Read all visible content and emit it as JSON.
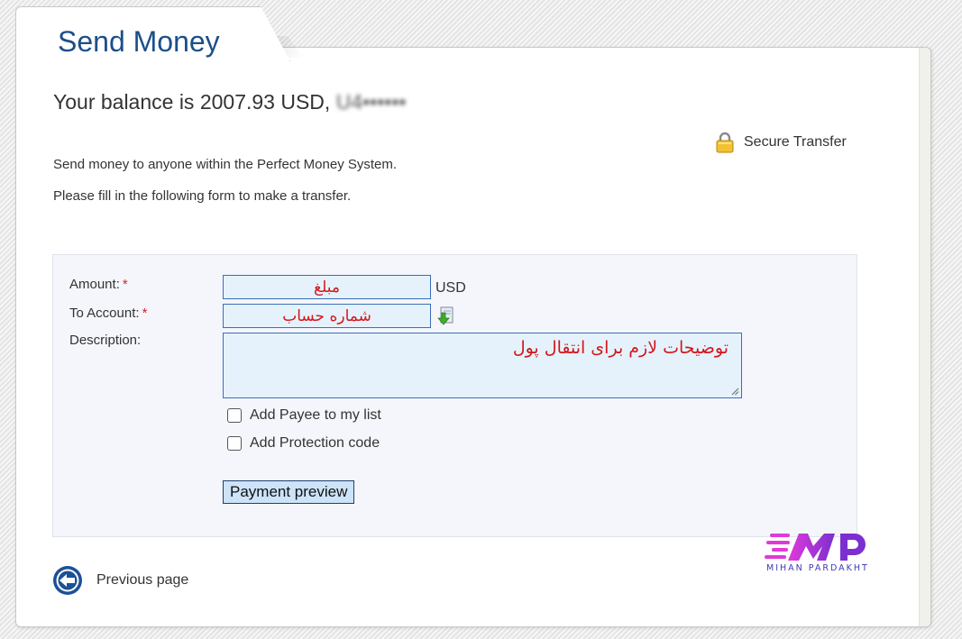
{
  "tab": {
    "title": "Send Money"
  },
  "balance": {
    "prefix": "Your balance is 2007.93 USD, ",
    "account_masked": "U4••••••"
  },
  "secure": {
    "label": "Secure Transfer"
  },
  "intro": {
    "line1": "Send money to anyone within the Perfect Money System.",
    "line2": "Please fill in the following form to make a transfer."
  },
  "form": {
    "amount": {
      "label": "Amount:",
      "required_mark": "*",
      "value": "مبلغ",
      "unit": "USD"
    },
    "to_account": {
      "label": "To Account:",
      "required_mark": "*",
      "value": "شماره حساب"
    },
    "description": {
      "label": "Description:",
      "value": "توضیحات لازم برای انتقال پول"
    },
    "add_payee": {
      "label": "Add Payee to my list",
      "checked": false
    },
    "add_protection": {
      "label": "Add Protection code",
      "checked": false
    },
    "submit_label": "Payment preview"
  },
  "footer": {
    "previous_label": "Previous page"
  },
  "watermark": {
    "brand": "MIHAN PARDAKHT"
  },
  "colors": {
    "title": "#1b4f8a",
    "field_bg": "#e5f2fc",
    "field_border": "#3a6fb8",
    "annotation_red": "#d4161a",
    "brand_purple": "#7b2fd0",
    "brand_pink": "#e03ad8"
  },
  "icons": {
    "lock": "lock-icon",
    "address_book": "address-book-icon",
    "back": "back-arrow-icon"
  }
}
